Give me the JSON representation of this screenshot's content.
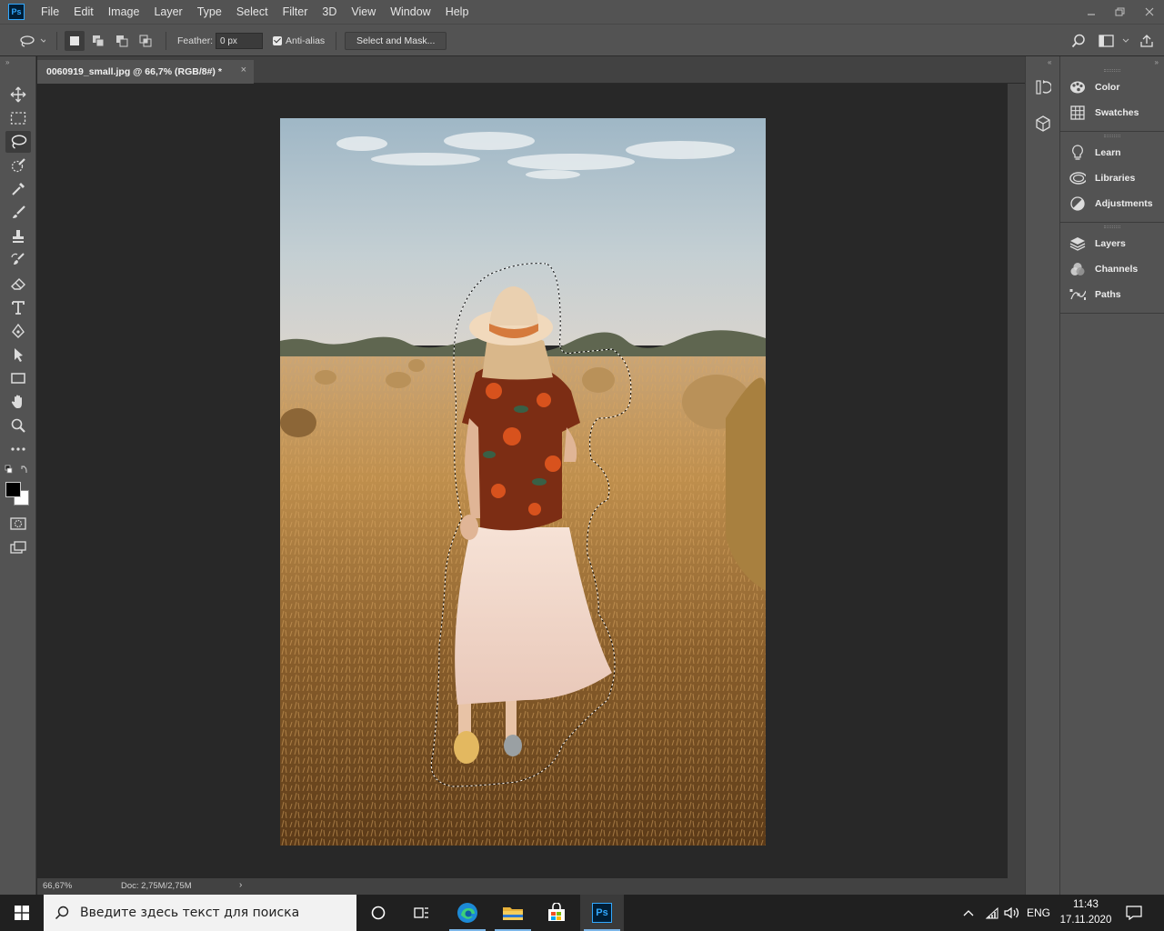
{
  "menubar": {
    "logo": "Ps",
    "items": [
      "File",
      "Edit",
      "Image",
      "Layer",
      "Type",
      "Select",
      "Filter",
      "3D",
      "View",
      "Window",
      "Help"
    ],
    "controls": [
      "minimize-icon",
      "restore-icon",
      "close-icon"
    ]
  },
  "options": {
    "tool": "lasso-icon",
    "feather_label": "Feather:",
    "feather_value": "0 px",
    "antialias_label": "Anti-alias",
    "antialias_checked": true,
    "select_mask_label": "Select and Mask..."
  },
  "document": {
    "tab_title": "0060919_small.jpg @ 66,7% (RGB/8#) *",
    "close": "×"
  },
  "status": {
    "zoom": "66,67%",
    "doc": "Doc: 2,75M/2,75M",
    "arrow": "›"
  },
  "panels": {
    "group1": [
      {
        "label": "Color",
        "icon": "color-palette-icon"
      },
      {
        "label": "Swatches",
        "icon": "swatches-grid-icon"
      }
    ],
    "group2": [
      {
        "label": "Learn",
        "icon": "lightbulb-icon"
      },
      {
        "label": "Libraries",
        "icon": "libraries-icon"
      },
      {
        "label": "Adjustments",
        "icon": "adjustments-icon"
      }
    ],
    "group3": [
      {
        "label": "Layers",
        "icon": "layers-icon"
      },
      {
        "label": "Channels",
        "icon": "channels-icon"
      },
      {
        "label": "Paths",
        "icon": "paths-icon"
      }
    ]
  },
  "taskbar": {
    "search_placeholder": "Введите здесь текст для поиска",
    "language": "ENG",
    "time": "11:43",
    "date": "17.11.2020"
  },
  "colors": {
    "ui_dark": "#535353",
    "canvas_bg": "#282828",
    "ps_blue": "#31a8ff"
  }
}
